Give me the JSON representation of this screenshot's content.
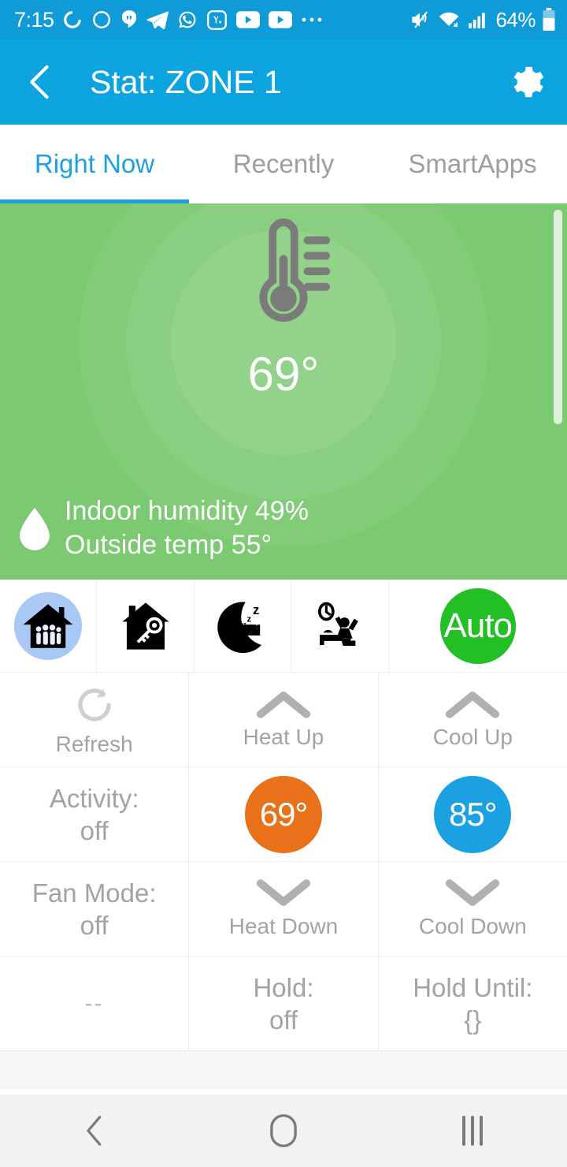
{
  "status_bar": {
    "time": "7:15",
    "battery_text": "64%",
    "left_icons": [
      "pocketcast-icon",
      "circle-assistant-icon",
      "hangouts-icon",
      "telegram-icon",
      "whatsapp-icon",
      "app-badge-icon",
      "youtube-icon",
      "youtube-icon",
      "more-dots-icon"
    ],
    "right_icons": [
      "mute-vibrate-icon",
      "wifi-icon",
      "cellular-signal-icon",
      "battery-icon"
    ]
  },
  "app_bar": {
    "back_label": "back-chevron",
    "title": "Stat: ZONE 1",
    "settings_label": "gear-icon"
  },
  "tabs": [
    {
      "label": "Right Now",
      "active": true
    },
    {
      "label": "Recently",
      "active": false
    },
    {
      "label": "SmartApps",
      "active": false
    }
  ],
  "hero": {
    "temperature": "69°",
    "humidity_line": "Indoor humidity 49%",
    "outside_line": "Outside temp 55°",
    "background_color": "#7BC970",
    "thermometer_color": "#7b7b7b"
  },
  "modes": [
    {
      "name": "home",
      "icon": "house-with-family-icon",
      "selected": true
    },
    {
      "name": "away",
      "icon": "house-with-key-icon",
      "selected": false
    },
    {
      "name": "night",
      "icon": "moon-bed-sleep-icon",
      "selected": false
    },
    {
      "name": "wake",
      "icon": "alarm-wake-up-icon",
      "selected": false
    }
  ],
  "mode_badge": {
    "label": "Auto",
    "color": "#22C024"
  },
  "controls": {
    "row1": [
      {
        "type": "icon-label",
        "icon": "refresh-icon",
        "label": "Refresh"
      },
      {
        "type": "icon-label",
        "icon": "chevron-up-icon",
        "label": "Heat Up"
      },
      {
        "type": "icon-label",
        "icon": "chevron-up-icon",
        "label": "Cool Up"
      }
    ],
    "row2": [
      {
        "type": "text",
        "line1": "Activity:",
        "line2": "off"
      },
      {
        "type": "pill",
        "value": "69°",
        "color": "#E8711A"
      },
      {
        "type": "pill",
        "value": "85°",
        "color": "#1BA1E2"
      }
    ],
    "row3": [
      {
        "type": "text",
        "line1": "Fan Mode:",
        "line2": "off"
      },
      {
        "type": "icon-label",
        "icon": "chevron-down-icon",
        "label": "Heat Down"
      },
      {
        "type": "icon-label",
        "icon": "chevron-down-icon",
        "label": "Cool Down"
      }
    ],
    "row4": [
      {
        "type": "text",
        "line1": "--",
        "line2": ""
      },
      {
        "type": "text",
        "line1": "Hold:",
        "line2": "off"
      },
      {
        "type": "text",
        "line1": "Hold Until:",
        "line2": "{}"
      }
    ]
  },
  "nav_bar": {
    "back": "nav-back-icon",
    "home": "nav-home-icon",
    "recents": "nav-recents-icon"
  }
}
